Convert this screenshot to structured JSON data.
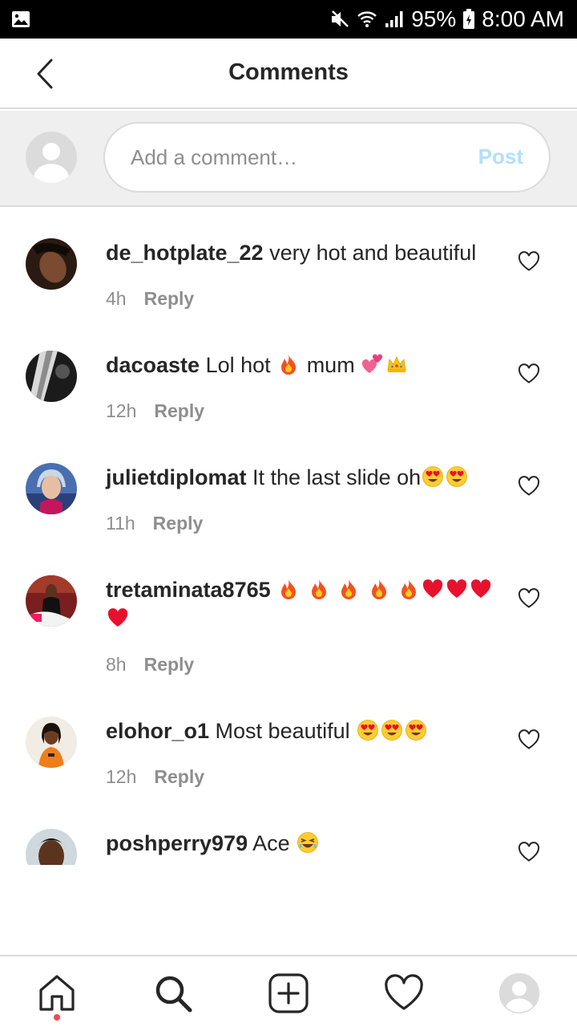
{
  "status_bar": {
    "battery": "95%",
    "time": "8:00 AM"
  },
  "header": {
    "title": "Comments"
  },
  "comment_box": {
    "placeholder": "Add a comment…",
    "post_label": "Post"
  },
  "comments": [
    {
      "username": "de_hotplate_22",
      "text": "very hot and beautiful",
      "time": "4h",
      "reply": "Reply"
    },
    {
      "username": "dacoaste",
      "text_parts": [
        "Lol hot",
        "mum"
      ],
      "time": "12h",
      "reply": "Reply"
    },
    {
      "username": "julietdiplomat",
      "text": "It the last slide oh",
      "time": "11h",
      "reply": "Reply"
    },
    {
      "username": "tretaminata8765",
      "text": "",
      "time": "8h",
      "reply": "Reply"
    },
    {
      "username": "elohor_o1",
      "text": "Most beautiful",
      "time": "12h",
      "reply": "Reply"
    },
    {
      "username": "poshperry979",
      "text": "Ace",
      "time": "",
      "reply": ""
    }
  ],
  "icons": {
    "back": "chevron-left-icon",
    "like": "heart-outline-icon",
    "nav": [
      "home-icon",
      "search-icon",
      "add-post-icon",
      "activity-heart-icon",
      "profile-avatar-icon"
    ]
  },
  "colors": {
    "post_disabled": "#b2dffc",
    "meta_gray": "#8e8e8e",
    "notification_dot": "#ed4956"
  }
}
